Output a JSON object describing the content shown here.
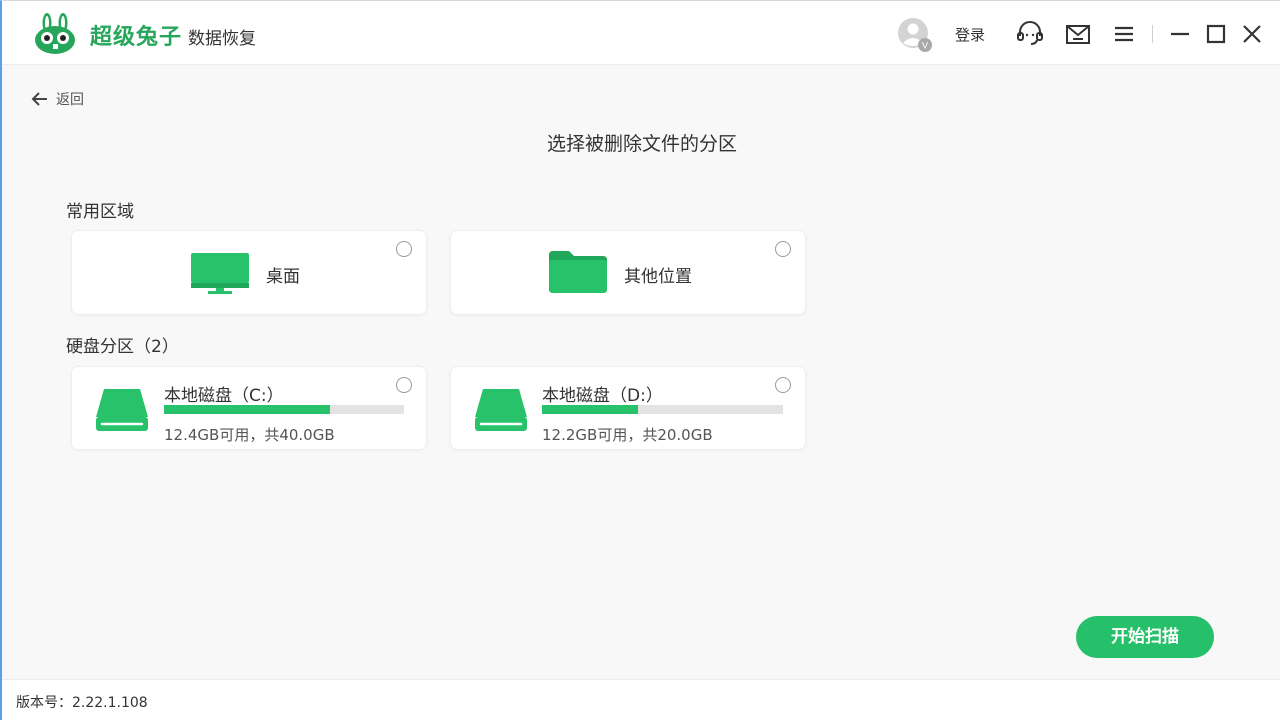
{
  "app": {
    "brand_name": "超级兔子",
    "brand_sub": "数据恢复",
    "login_label": "登录",
    "avatar_badge": "V"
  },
  "nav": {
    "back_label": "返回"
  },
  "main": {
    "title": "选择被删除文件的分区",
    "common_section": "常用区域",
    "common_items": [
      {
        "label": "桌面",
        "icon": "monitor-icon"
      },
      {
        "label": "其他位置",
        "icon": "folder-icon"
      }
    ],
    "disk_section": "硬盘分区（2）",
    "disks": [
      {
        "name": "本地磁盘（C:）",
        "info": "12.4GB可用，共40.0GB",
        "used_fraction": 0.69
      },
      {
        "name": "本地磁盘（D:）",
        "info": "12.2GB可用，共20.0GB",
        "used_fraction": 0.4
      }
    ],
    "scan_button": "开始扫描"
  },
  "footer": {
    "version": "版本号：2.22.1.108"
  },
  "colors": {
    "accent": "#27c06a",
    "bar_track": "#e3e3e3"
  }
}
